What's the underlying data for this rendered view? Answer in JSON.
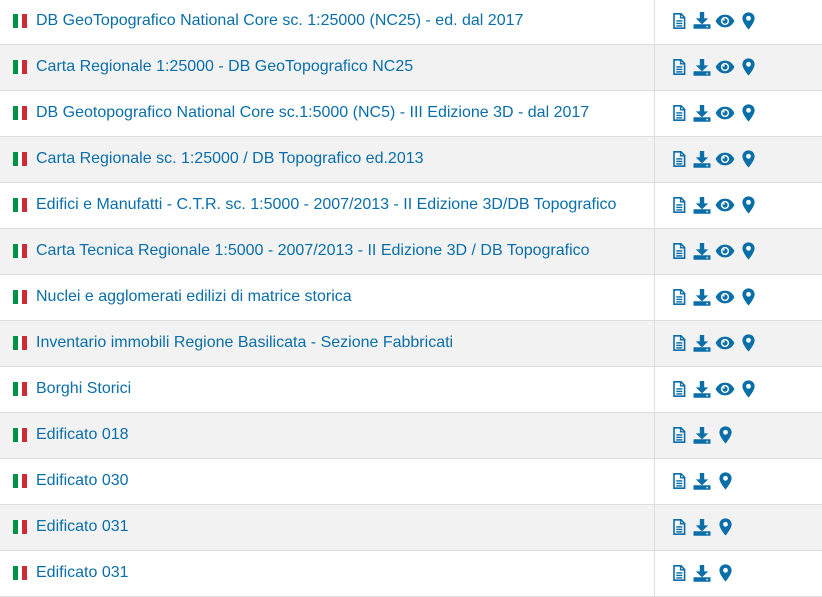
{
  "rows": [
    {
      "title": "DB GeoTopografico National Core sc. 1:25000 (NC25) - ed. dal 2017",
      "has_view": true
    },
    {
      "title": "Carta Regionale 1:25000 - DB GeoTopografico NC25",
      "has_view": true
    },
    {
      "title": "DB Geotopografico National Core sc.1:5000 (NC5) - III Edizione 3D - dal 2017",
      "has_view": true
    },
    {
      "title": "Carta Regionale sc. 1:25000 / DB Topografico ed.2013",
      "has_view": true
    },
    {
      "title": "Edifici e Manufatti - C.T.R. sc. 1:5000 - 2007/2013 - II Edizione 3D/DB Topografico",
      "has_view": true
    },
    {
      "title": "Carta Tecnica Regionale 1:5000 - 2007/2013 - II Edizione 3D / DB Topografico",
      "has_view": true
    },
    {
      "title": "Nuclei e agglomerati edilizi di matrice storica",
      "has_view": true
    },
    {
      "title": "Inventario immobili Regione Basilicata - Sezione Fabbricati",
      "has_view": true
    },
    {
      "title": "Borghi Storici",
      "has_view": true
    },
    {
      "title": "Edificato 018",
      "has_view": false
    },
    {
      "title": "Edificato 030",
      "has_view": false
    },
    {
      "title": "Edificato 031",
      "has_view": false
    },
    {
      "title": "Edificato 031",
      "has_view": false
    }
  ],
  "icons": {
    "flag": "italy-flag-icon",
    "metadata": "file-text-icon",
    "download": "download-icon",
    "view": "eye-icon",
    "locate": "map-marker-icon"
  },
  "colors": {
    "link": "#0a6ea8",
    "icon": "#0a6ea8",
    "flag_green": "#009246",
    "flag_white": "#ffffff",
    "flag_red": "#ce2b37",
    "row_alt": "#f2f2f2",
    "border": "#dddddd"
  }
}
